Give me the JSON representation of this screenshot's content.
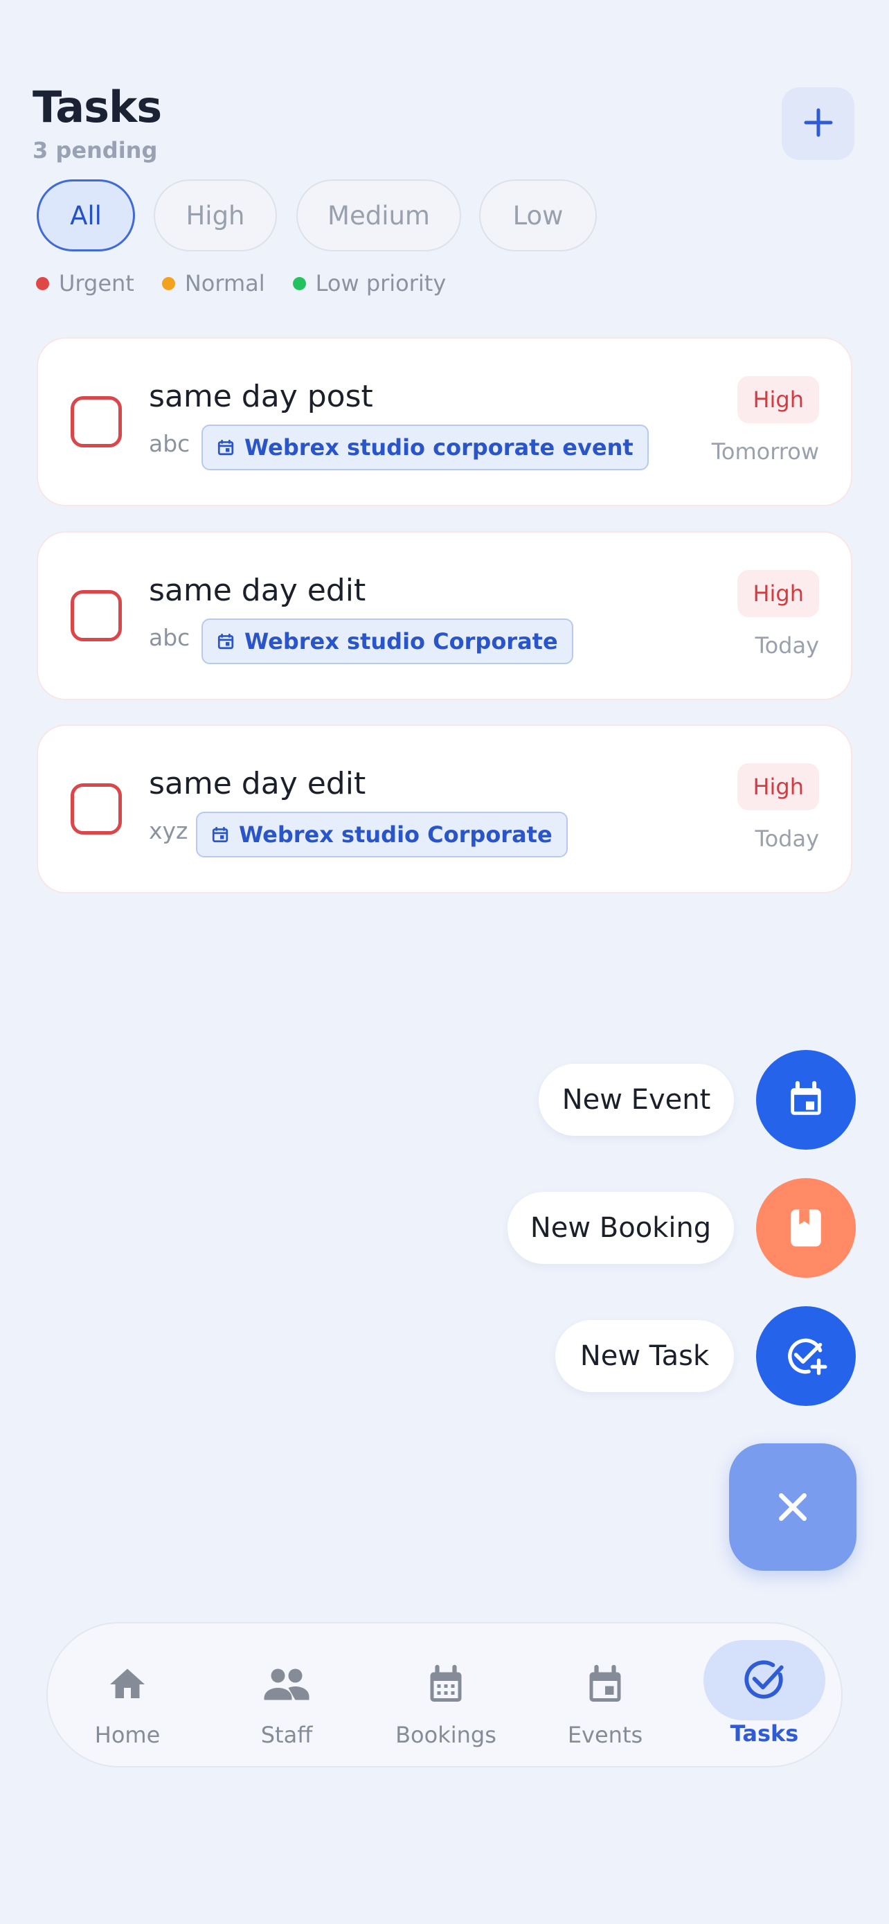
{
  "header": {
    "title": "Tasks",
    "subtitle": "3 pending",
    "add_icon": "plus-icon"
  },
  "filters": [
    {
      "label": "All",
      "active": true
    },
    {
      "label": "High",
      "active": false
    },
    {
      "label": "Medium",
      "active": false
    },
    {
      "label": "Low",
      "active": false
    }
  ],
  "legend": [
    {
      "label": "Urgent",
      "color": "#e04848"
    },
    {
      "label": "Normal",
      "color": "#f2a21c"
    },
    {
      "label": "Low priority",
      "color": "#22c35e"
    }
  ],
  "tasks": [
    {
      "title": "same day post",
      "description": "abc",
      "event": "Webrex studio corporate event",
      "priority": "High",
      "due": "Tomorrow"
    },
    {
      "title": "same day edit",
      "description": "abc",
      "event": "Webrex studio Corporate",
      "priority": "High",
      "due": "Today"
    },
    {
      "title": "same day edit",
      "description": "xyz",
      "event": "Webrex studio Corporate",
      "priority": "High",
      "due": "Today"
    }
  ],
  "fab_menu": [
    {
      "label": "New Event",
      "icon": "calendar-icon",
      "color": "#2563eb"
    },
    {
      "label": "New Booking",
      "icon": "book-icon",
      "color": "#ff8a65"
    },
    {
      "label": "New Task",
      "icon": "task-add-icon",
      "color": "#2563eb"
    }
  ],
  "fab_close_icon": "close-icon",
  "nav": [
    {
      "label": "Home",
      "icon": "home-icon",
      "active": false
    },
    {
      "label": "Staff",
      "icon": "people-icon",
      "active": false
    },
    {
      "label": "Bookings",
      "icon": "calendar-grid-icon",
      "active": false
    },
    {
      "label": "Events",
      "icon": "calendar-icon",
      "active": false
    },
    {
      "label": "Tasks",
      "icon": "check-circle-icon",
      "active": true
    }
  ],
  "colors": {
    "accent": "#2f5bd4",
    "high_priority": "#d03c3f",
    "background": "#eef2fb"
  }
}
